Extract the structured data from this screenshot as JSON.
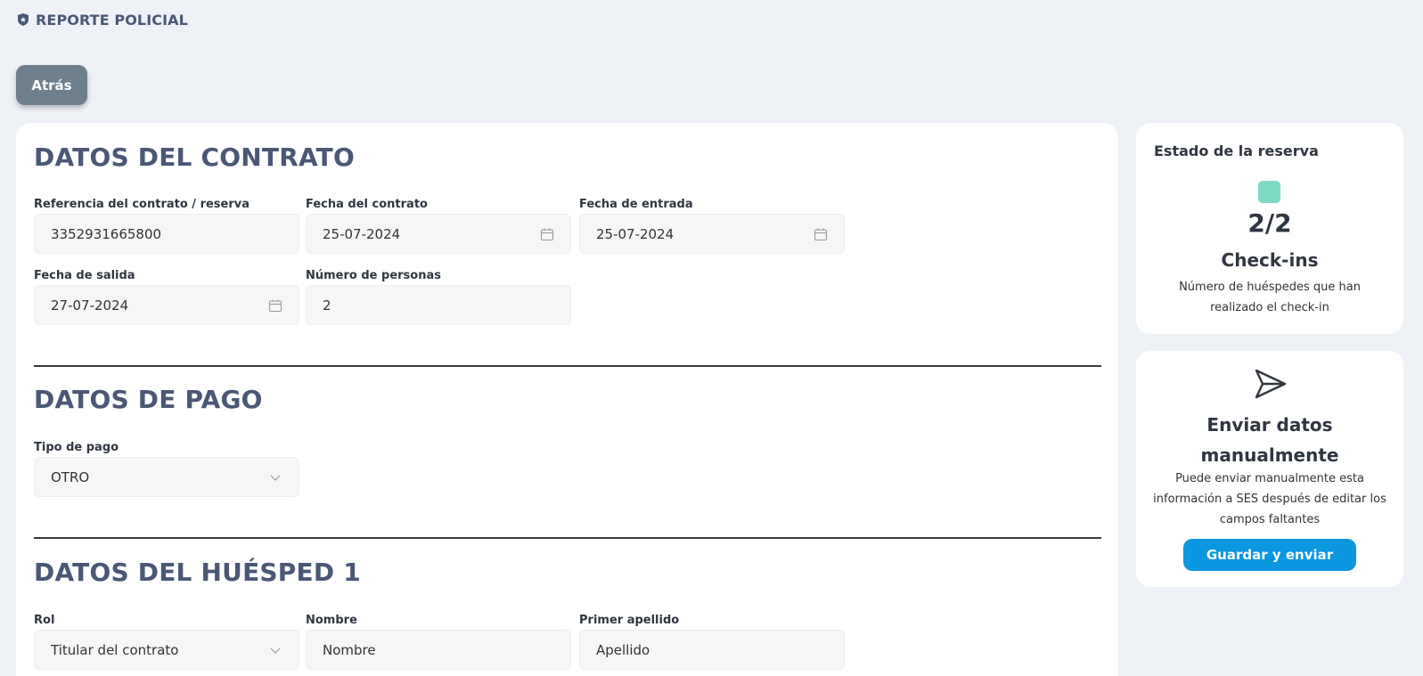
{
  "header": {
    "title": "REPORTE POLICIAL",
    "icon": "police-badge-icon"
  },
  "back_button": {
    "label": "Atrás"
  },
  "contract": {
    "title": "DATOS DEL CONTRATO",
    "reference": {
      "label": "Referencia del contrato / reserva",
      "value": "3352931665800"
    },
    "contract_date": {
      "label": "Fecha del contrato",
      "value": "25-07-2024"
    },
    "entry_date": {
      "label": "Fecha de entrada",
      "value": "25-07-2024"
    },
    "exit_date": {
      "label": "Fecha de salida",
      "value": "27-07-2024"
    },
    "persons": {
      "label": "Número de personas",
      "value": "2"
    }
  },
  "payment": {
    "title": "DATOS DE PAGO",
    "type": {
      "label": "Tipo de pago",
      "value": "OTRO"
    }
  },
  "guest": {
    "title": "DATOS DEL HUÉSPED 1",
    "role": {
      "label": "Rol",
      "value": "Titular del contrato"
    },
    "name": {
      "label": "Nombre",
      "placeholder": "Nombre"
    },
    "surname": {
      "label": "Primer apellido",
      "placeholder": "Apellido"
    }
  },
  "reservation_status": {
    "title": "Estado de la reserva",
    "status_color": "#7dd9c4",
    "count": "2/2",
    "label": "Check-ins",
    "description": "Número de huéspedes que han realizado el check-in"
  },
  "manual_send": {
    "icon": "send-icon",
    "title": "Enviar datos manualmente",
    "description": "Puede enviar manualmente esta información a SES después de editar los campos faltantes",
    "button_label": "Guardar y enviar",
    "button_color": "#0b96e0"
  }
}
